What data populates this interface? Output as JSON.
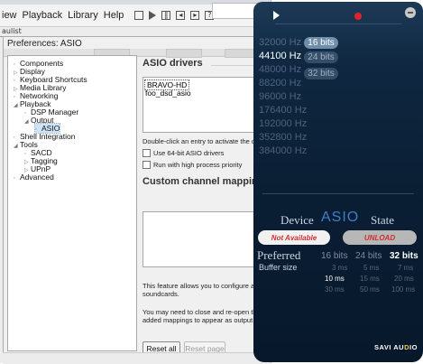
{
  "menubar": {
    "items": [
      "iew",
      "Playback",
      "Library",
      "Help"
    ]
  },
  "playlist_tab": "aulist",
  "prefs": {
    "title": "Preferences: ASIO",
    "tree": [
      {
        "label": "Components",
        "indent": 1
      },
      {
        "label": "Display",
        "indent": 1
      },
      {
        "label": "Keyboard Shortcuts",
        "indent": 1
      },
      {
        "label": "Media Library",
        "indent": 1
      },
      {
        "label": "Networking",
        "indent": 1
      },
      {
        "label": "Playback",
        "indent": 1
      },
      {
        "label": "DSP Manager",
        "indent": 2
      },
      {
        "label": "Output",
        "indent": 2
      },
      {
        "label": "ASIO",
        "indent": 3,
        "selected": true
      },
      {
        "label": "Shell Integration",
        "indent": 1
      },
      {
        "label": "Tools",
        "indent": 1
      },
      {
        "label": "SACD",
        "indent": 2
      },
      {
        "label": "Tagging",
        "indent": 2
      },
      {
        "label": "UPnP",
        "indent": 2
      },
      {
        "label": "Advanced",
        "indent": 1
      }
    ],
    "asio_drivers_title": "ASIO drivers",
    "drivers": [
      "BRAVO-HD",
      "foo_dsd_asio"
    ],
    "activate_hint": "Double-click an entry to activate the drive",
    "use64": "Use 64-bit ASIO drivers",
    "high_priority": "Run with high process priority",
    "mappings_title": "Custom channel mappings",
    "info1_line1": "This feature allows you to configure altern",
    "info1_line2": "soundcards.",
    "info2_line1": "You may need to close and re-open the fo",
    "info2_line2": "added mappings to appear as output devic",
    "reset_all": "Reset all",
    "reset_page": "Reset page"
  },
  "savi": {
    "frequencies": [
      "32000 Hz",
      "44100 Hz",
      "48000 Hz",
      "88200 Hz",
      "96000 Hz",
      "176400 Hz",
      "192000 Hz",
      "352800 Hz",
      "384000 Hz"
    ],
    "active_frequency": "44100 Hz",
    "freq_bits_pills": [
      "16 bits",
      "24 bits",
      "32 bits"
    ],
    "device_label": "Device",
    "asio_label": "ASIO",
    "state_label": "State",
    "not_available": "Not Available",
    "unload": "UNLOAD",
    "preferred_label": "Preferred",
    "buffer_size_label": "Buffer size",
    "preferred_bits": [
      "16 bits",
      "24 bits",
      "32 bits"
    ],
    "active_preferred_bits": "32 bits",
    "buffer_rows": [
      [
        "3 ms",
        "5 ms",
        "7 ms"
      ],
      [
        "10 ms",
        "15 ms",
        "20 ms"
      ],
      [
        "30 ms",
        "50 ms",
        "100 ms"
      ]
    ],
    "active_buffer": "10 ms",
    "logo_main": "SAVI AU",
    "logo_accent": "D",
    "logo_end": "IO",
    "colors": {
      "accent_blue": "#3f7ec9",
      "pill_active": "#6f8ea9",
      "danger_red": "#d02f2f",
      "record_red": "#e0232d"
    }
  }
}
